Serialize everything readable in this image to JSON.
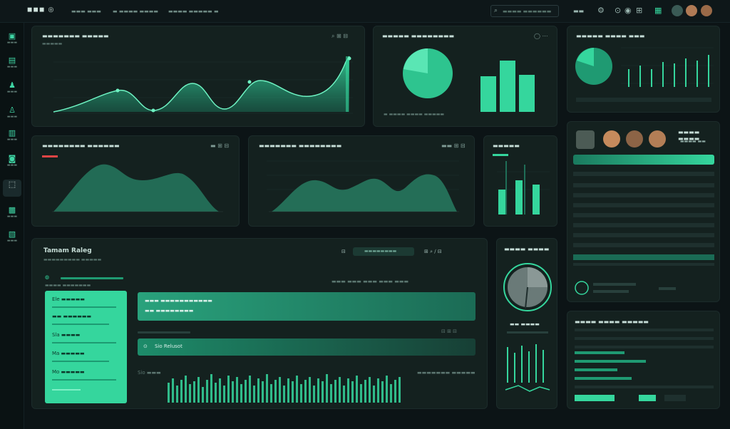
{
  "colors": {
    "accent": "#35d69d",
    "accent_dark": "#1f9a72",
    "panel": "#14211f",
    "background": "#0c1416"
  },
  "header": {
    "logo": "◼◼◼ ◎",
    "tabs": [
      "▬▬▬ ▬▬▬",
      "▬ ▬▬▬▬ ▬▬▬▬",
      "▬▬▬▬ ▬▬▬▬▬ ▬"
    ],
    "search_placeholder": "▬▬▬▬ ▬▬▬▬▬▬",
    "icons": [
      "menu-icon",
      "settings-icon",
      "bell-icon",
      "grid-icon",
      "globe-icon"
    ]
  },
  "sidebar": {
    "items": [
      {
        "icon": "grid-icon",
        "label": "▬▬▬"
      },
      {
        "icon": "file-icon",
        "label": "▬▬▬"
      },
      {
        "icon": "user-icon",
        "label": "▬▬▬"
      },
      {
        "icon": "person-icon",
        "label": "▬▬▬"
      },
      {
        "icon": "image-icon",
        "label": "▬▬▬"
      },
      {
        "icon": "box-icon",
        "label": "▬▬▬"
      },
      {
        "icon": "chart-icon",
        "label": "▬▬▬"
      },
      {
        "icon": "layers-icon",
        "label": "▬▬▬"
      }
    ]
  },
  "panels": {
    "main_area": {
      "title": "▬▬▬▬▬▬▬ ▬▬▬▬▬",
      "subtitle": "▬▬▬▬▬",
      "controls": "⌕ ⊞ ⊟"
    },
    "pie_bars": {
      "title": "▬▬▬▬▬ ▬▬▬▬▬▬▬▬",
      "controls": "◯ ⋯",
      "legend": "▬ ▬▬▬▬ ▬▬▬▬ ▬▬▬▬▬"
    },
    "mini_pie": {
      "title": "▬▬▬▬▬ ▬▬▬▬ ▬▬▬"
    },
    "hills_left": {
      "title": "▬▬▬▬▬▬▬▬ ▬▬▬▬▬▬",
      "controls": "▬ ⊞ ⊟"
    },
    "hills_mid": {
      "title": "▬▬▬▬▬▬▬ ▬▬▬▬▬▬▬▬",
      "controls": "▬▬ ⊞ ⊟"
    },
    "small_bars": {
      "title": "▬▬▬▬▬"
    },
    "profile": {
      "title": "▬▬▬▬ ▬▬▬▬",
      "subtitle": "▬▬▬▬ ▬▬"
    },
    "workspace": {
      "title": "Tamam Raleg",
      "subtitle": "▬▬▬▬▬▬▬▬▬ ▬▬▬▬▬",
      "search_label": "▬▬▬▬▬▬▬▬",
      "section_label": "▬▬▬▬ ▬▬▬▬▬▬▬",
      "card_rows": [
        "Ele ▬▬▬▬▬",
        "▬▬ ▬▬▬▬▬▬",
        "Sla ▬▬▬▬",
        "Ma ▬▬▬▬▬",
        "Mo ▬▬▬▬▬"
      ],
      "band1_title": "▬▬▬ ▬▬▬▬▬▬▬▬▬▬▬",
      "band1_sub": "▬▬ ▬▬▬▬▬▬▬▬",
      "band2_label": "Sio Relusot",
      "footer_label": "Sio ▬▬▬",
      "footer_right": "▬▬▬▬▬▬▬ ▬▬▬▬▬"
    },
    "gauge": {
      "title": "▬▬▬▬ ▬▬▬▬",
      "caption": "▬▬ ▬▬▬▬"
    },
    "table": {
      "title": "▬▬▬▬ ▬▬▬▬ ▬▬▬▬▬"
    }
  }
}
